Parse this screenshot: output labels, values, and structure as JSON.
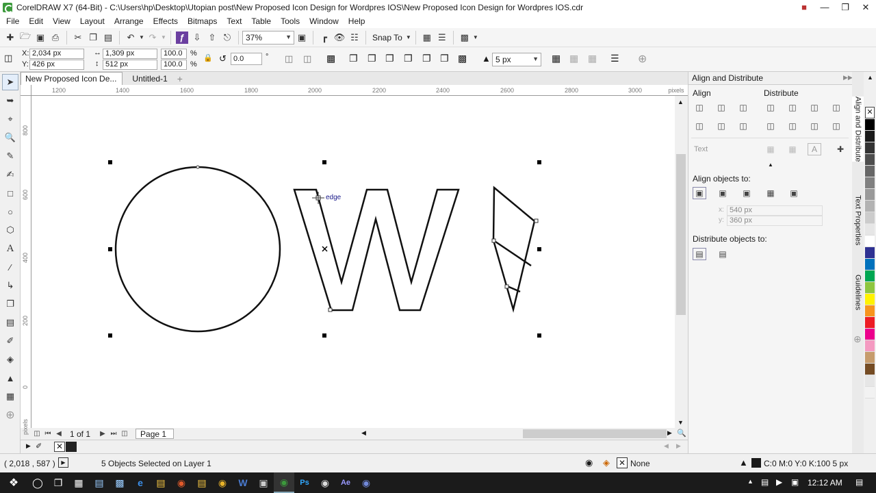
{
  "window": {
    "title": "CorelDRAW X7 (64-Bit) - C:\\Users\\hp\\Desktop\\Utopian post\\New Proposed Icon Design for Wordpres IOS\\New Proposed Icon Design for Wordpres IOS.cdr"
  },
  "menu": [
    "File",
    "Edit",
    "View",
    "Layout",
    "Arrange",
    "Effects",
    "Bitmaps",
    "Text",
    "Table",
    "Tools",
    "Window",
    "Help"
  ],
  "toolbar": {
    "zoom": "37%",
    "snap_to": "Snap To"
  },
  "propbar": {
    "x_label": "X:",
    "x": "2,034 px",
    "y_label": "Y:",
    "y": "426 px",
    "w": "1,309 px",
    "h": "512 px",
    "sx": "100.0",
    "sy": "100.0",
    "pct": "%",
    "angle": "0.0",
    "deg": "°",
    "outline": "5 px"
  },
  "tabs": [
    "New Proposed Icon De...",
    "Untitled-1"
  ],
  "ruler": {
    "h_ticks": [
      "1200",
      "1400",
      "1600",
      "1800",
      "2000",
      "2200",
      "2400",
      "2600",
      "2800",
      "3000"
    ],
    "h_unit": "pixels",
    "v_ticks": [
      "800",
      "600",
      "400",
      "200",
      "0"
    ],
    "v_unit": "pixels"
  },
  "canvas": {
    "edge_label": "edge"
  },
  "pagenav": {
    "count": "1 of 1",
    "page_tab": "Page 1"
  },
  "docker": {
    "title": "Align and Distribute",
    "align": "Align",
    "distribute": "Distribute",
    "text": "Text",
    "align_to": "Align objects to:",
    "x_label": "x:",
    "x": "540 px",
    "y_label": "y:",
    "y": "360 px",
    "distribute_to": "Distribute objects to:"
  },
  "sidetabs": [
    "Align and Distribute",
    "Text Properties",
    "Guidelines"
  ],
  "palette": [
    "#000000",
    "#1a1a1a",
    "#333333",
    "#4d4d4d",
    "#666666",
    "#808080",
    "#999999",
    "#b3b3b3",
    "#cccccc",
    "#e6e6e6",
    "#ffffff",
    "#2e3192",
    "#0071bc",
    "#00a651",
    "#8dc63f",
    "#fff200",
    "#f7941d",
    "#ed1c24",
    "#ec008c",
    "#f49ac1",
    "#c69c6d",
    "#754c24",
    "#e6e6e6",
    "#f2f2f2"
  ],
  "status": {
    "coords": "( 2,018 , 587 )",
    "selection": "5 Objects Selected on Layer 1",
    "fill": "None",
    "outline": "C:0 M:0 Y:0 K:100  5 px"
  },
  "taskbar": {
    "time": "12:12 AM"
  }
}
